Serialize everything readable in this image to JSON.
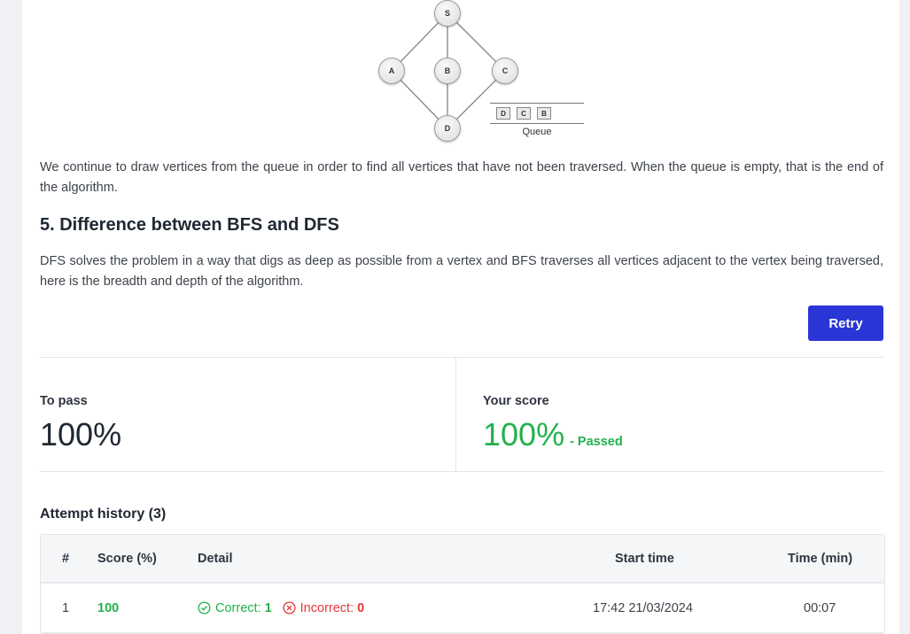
{
  "graph": {
    "nodes": [
      "S",
      "A",
      "B",
      "C",
      "D"
    ],
    "queue": [
      "D",
      "C",
      "B"
    ],
    "queue_label": "Queue"
  },
  "paragraph_1": "We continue to draw vertices from the queue in order to find all vertices that have not been traversed. When the queue is empty, that is the end of the algorithm.",
  "section_heading": "5. Difference between BFS and DFS",
  "paragraph_2": "DFS solves the problem in a way that digs as deep as possible from a vertex and BFS traverses all vertices adjacent to the vertex being traversed, here is the breadth and depth of the algorithm.",
  "retry_label": "Retry",
  "to_pass": {
    "label": "To pass",
    "value": "100%"
  },
  "your_score": {
    "label": "Your score",
    "value": "100%",
    "status": "- Passed"
  },
  "attempt_history": {
    "title": "Attempt history (3)",
    "headers": {
      "num": "#",
      "score": "Score (%)",
      "detail": "Detail",
      "start": "Start time",
      "time": "Time (min)"
    },
    "rows": [
      {
        "num": "1",
        "score": "100",
        "correct_label": "Correct:",
        "correct": "1",
        "incorrect_label": "Incorrect:",
        "incorrect": "0",
        "start": "17:42 21/03/2024",
        "time": "00:07"
      }
    ]
  },
  "colors": {
    "accent": "#2a35d6",
    "pass_green": "#22b14c",
    "fail_red": "#e53935"
  }
}
